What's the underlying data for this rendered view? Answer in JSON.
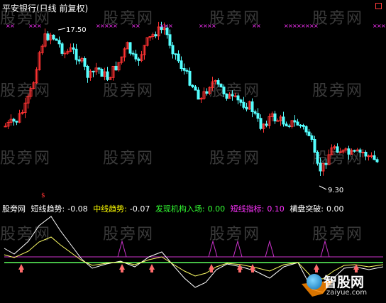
{
  "header": {
    "title": "平安银行(日线 前复权)"
  },
  "price_panel": {
    "high_label": "17.50",
    "low_label": "9.30"
  },
  "indicator": {
    "items": [
      {
        "label": "股旁网",
        "value": "",
        "color": "#ffffff"
      },
      {
        "label": "短线趋势:",
        "value": "-0.08",
        "color": "#ffffff"
      },
      {
        "label": "中线趋势:",
        "value": "-0.07",
        "color": "#ffff00"
      },
      {
        "label": "发现机构入场:",
        "value": "0.00",
        "color": "#33ff33"
      },
      {
        "label": "短线指标:",
        "value": "0.10",
        "color": "#ff33ff"
      },
      {
        "label": "横盘突破:",
        "value": "0.00",
        "color": "#ffffff"
      }
    ]
  },
  "watermarks": [
    "股旁网"
  ],
  "branding": {
    "name": "智股网",
    "url": "zaiyue.com"
  },
  "colors": {
    "up": "#ff3232",
    "down": "#54ffff",
    "marker": "#ff33ff"
  }
}
